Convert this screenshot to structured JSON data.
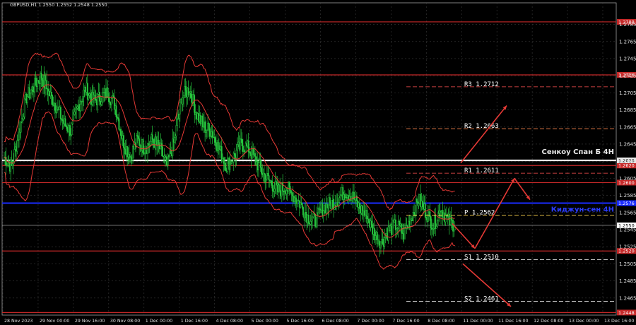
{
  "header": "GBPUSD,H1  1.2550 1.2552 1.2548 1.2550",
  "chart_data": {
    "type": "candlestick",
    "ylim": [
      1.2445,
      1.2802
    ],
    "y_ticks": [
      "1.2785",
      "1.2765",
      "1.2745",
      "1.2725",
      "1.2705",
      "1.2685",
      "1.2665",
      "1.2645",
      "1.2625",
      "1.2605",
      "1.2585",
      "1.2565",
      "1.2545",
      "1.2525",
      "1.2505",
      "1.2485",
      "1.2465"
    ],
    "x_ticks": [
      "28 Nov 2023",
      "29 Nov 00:00",
      "29 Nov 16:00",
      "30 Nov 08:00",
      "1 Dec 00:00",
      "1 Dec 16:00",
      "4 Dec 08:00",
      "5 Dec 00:00",
      "5 Dec 16:00",
      "6 Dec 08:00",
      "7 Dec 00:00",
      "7 Dec 16:00",
      "8 Dec 08:00",
      "11 Dec 00:00",
      "11 Dec 16:00",
      "12 Dec 08:00",
      "13 Dec 00:00",
      "13 Dec 16:00"
    ],
    "levels": [
      {
        "value": 1.2788,
        "label": "1.2788",
        "color": "#c62828"
      },
      {
        "value": 1.2726,
        "label": "1.2726",
        "color": "#c62828"
      },
      {
        "value": 1.262,
        "label": "1.2620",
        "color": "#c62828"
      },
      {
        "value": 1.26,
        "label": "1.2600",
        "color": "#c62828"
      },
      {
        "value": 1.252,
        "label": "1.2520",
        "color": "#c62828"
      },
      {
        "value": 1.2448,
        "label": "1.2448",
        "color": "#c62828"
      }
    ],
    "senkou": {
      "value": 1.2626,
      "label": "1.2626",
      "name": "Сенкоу Спан Б 4H",
      "color": "#e8e8e8"
    },
    "kijun": {
      "value": 1.2576,
      "label": "1.2576",
      "name": "Киджун-сен 4H",
      "color": "#1a2cff"
    },
    "current_price": {
      "value": 1.255,
      "label": "1.2550"
    },
    "pivots": [
      {
        "label": "R3",
        "value": "1.2712"
      },
      {
        "label": "R2",
        "value": "1.2663"
      },
      {
        "label": "R1",
        "value": "1.2611"
      },
      {
        "label": "P",
        "value": "1.2562"
      },
      {
        "label": "S1",
        "value": "1.2510"
      },
      {
        "label": "S2",
        "value": "1.2461"
      }
    ],
    "series": [
      1.263,
      1.2618,
      1.266,
      1.27,
      1.2712,
      1.2725,
      1.2705,
      1.269,
      1.267,
      1.266,
      1.269,
      1.271,
      1.2695,
      1.27,
      1.2705,
      1.269,
      1.265,
      1.263,
      1.265,
      1.264,
      1.265,
      1.264,
      1.262,
      1.265,
      1.27,
      1.271,
      1.268,
      1.2665,
      1.266,
      1.264,
      1.262,
      1.263,
      1.2645,
      1.264,
      1.2625,
      1.261,
      1.26,
      1.259,
      1.2595,
      1.2585,
      1.2575,
      1.256,
      1.2555,
      1.257,
      1.2575,
      1.258,
      1.259,
      1.2585,
      1.257,
      1.256,
      1.254,
      1.253,
      1.2545,
      1.255,
      1.254,
      1.256,
      1.258,
      1.2565,
      1.255,
      1.257,
      1.2555,
      1.255
    ]
  }
}
